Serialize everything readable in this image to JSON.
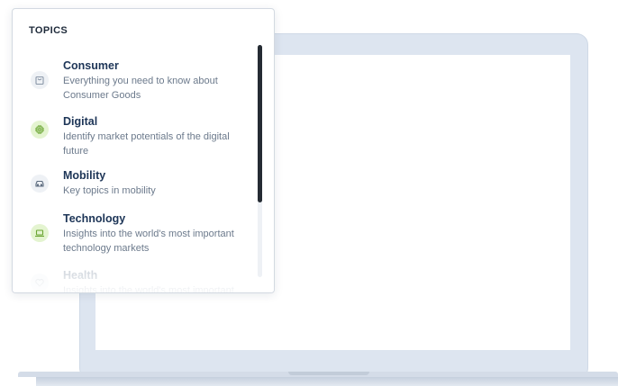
{
  "topics_menu": {
    "title": "TOPICS",
    "items": [
      {
        "label": "Consumer",
        "description": "Everything you need to know about Consumer Goods",
        "icon": "shopping-bag-icon",
        "icon_bg": "#eef1f5",
        "icon_color": "#8a97a8"
      },
      {
        "label": "Digital",
        "description": "Identify market potentials of the digital future",
        "icon": "chip-icon",
        "icon_bg": "#e4f4d0",
        "icon_color": "#6aa532"
      },
      {
        "label": "Mobility",
        "description": "Key topics in mobility",
        "icon": "car-icon",
        "icon_bg": "#eef1f5",
        "icon_color": "#5c6b7e"
      },
      {
        "label": "Technology",
        "description": "Insights into the world's most important technology markets",
        "icon": "laptop-icon",
        "icon_bg": "#e4f4d0",
        "icon_color": "#6aa532"
      },
      {
        "label": "Health",
        "description": "Insights into the world's most important",
        "icon": "heart-icon",
        "icon_bg": "#eef1f5",
        "icon_color": "#b0b9c4"
      }
    ]
  }
}
